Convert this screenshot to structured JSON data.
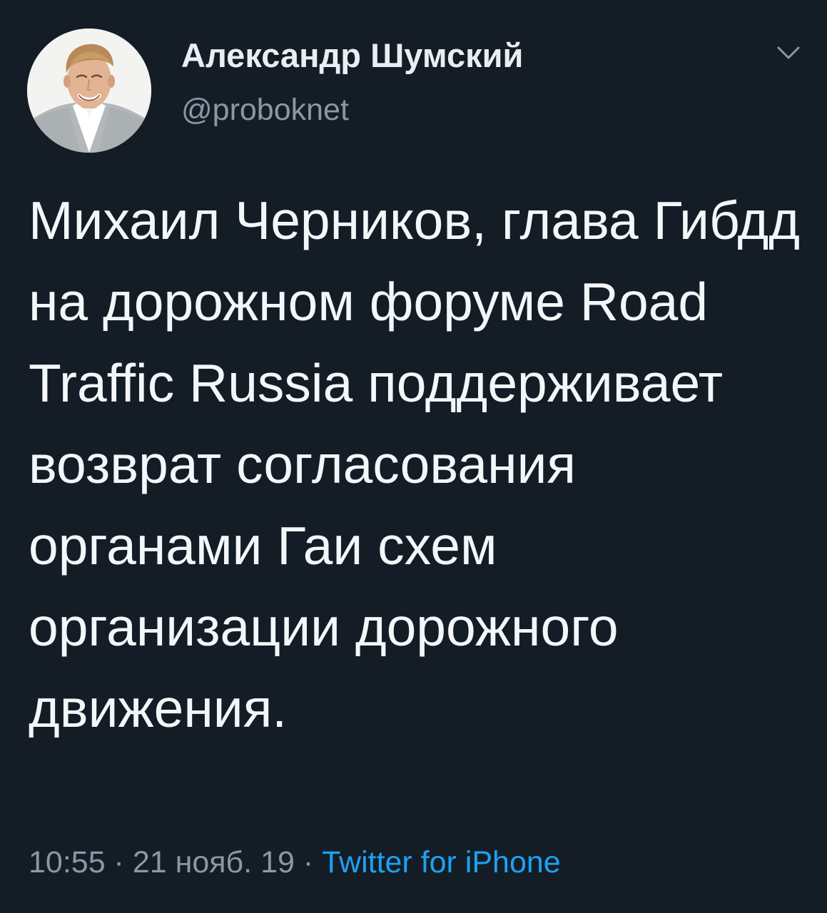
{
  "colors": {
    "background": "#141d26",
    "text_primary": "#f4f7fa",
    "text_secondary": "#8a98a6",
    "link": "#1da1f2"
  },
  "icons": {
    "avatar": "profile-photo",
    "menu": "chevron-down-icon"
  },
  "author": {
    "name": "Александр Шумский",
    "handle": "@proboknet"
  },
  "tweet": {
    "text": "Михаил Черников, глава Гибдд на дорожном форуме Road Traffic Russia поддерживает возврат согласования органами Гаи схем организации дорожного движения."
  },
  "meta": {
    "time": "10:55",
    "separator_1": " · ",
    "date": "21 нояб. 19",
    "separator_2": " · ",
    "source": "Twitter for iPhone"
  }
}
